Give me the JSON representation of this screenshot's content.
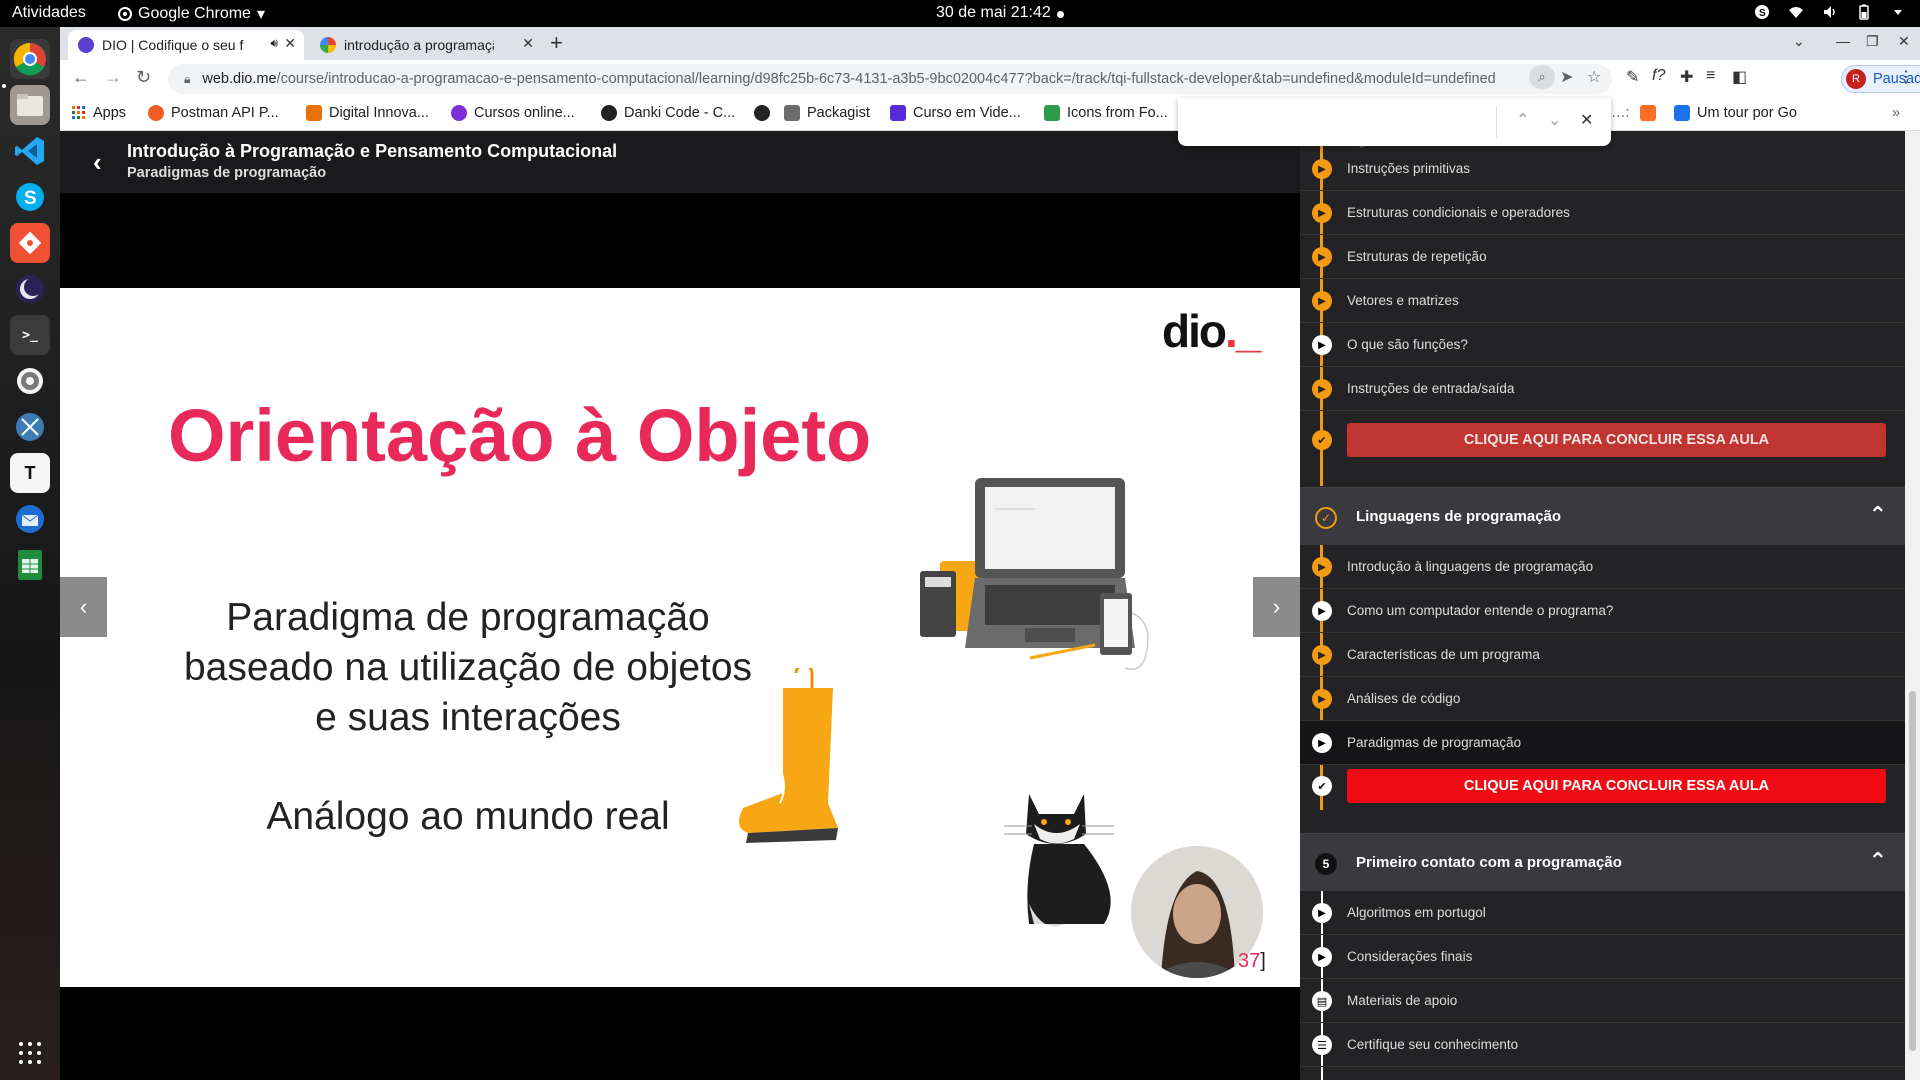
{
  "system_bar": {
    "activities": "Atividades",
    "app_name": "Google Chrome",
    "datetime": "30 de mai  21:42"
  },
  "tabs": [
    {
      "title": "DIO | Codifique o seu f",
      "active": true,
      "audio": true
    },
    {
      "title": "introdução a programação",
      "active": false
    }
  ],
  "toolbar": {
    "url_host": "web.dio.me",
    "url_path": "/course/introducao-a-programacao-e-pensamento-computacional/learning/d98fc25b-6c73-4131-a3b5-9bc02004c477?back=/track/tqi-fullstack-developer&tab=undefined&moduleId=undefined",
    "profile_initial": "R",
    "profile_label": "Pausada"
  },
  "bookmarks": [
    {
      "label": "Apps",
      "color": "#e8710a"
    },
    {
      "label": "Postman API P...",
      "color": "#ef5b25"
    },
    {
      "label": "Digital Innova...",
      "color": "#e8710a"
    },
    {
      "label": "Cursos online...",
      "color": "#7b2fd6"
    },
    {
      "label": "Danki Code - C...",
      "color": "#222222"
    },
    {
      "label": "",
      "color": "#222222"
    },
    {
      "label": "Packagist",
      "color": "#6d6d6d"
    },
    {
      "label": "Curso em Vide...",
      "color": "#5b2ad8"
    },
    {
      "label": "Icons from Fo...",
      "color": "#2e9b4a"
    },
    {
      "label": "Um tour por Go",
      "color": "#1a73e8"
    }
  ],
  "find_bar": {
    "query": ""
  },
  "course": {
    "title": "Introdução à Programação e Pensamento Computacional",
    "lesson": "Paradigmas de programação"
  },
  "slide": {
    "logo": "dio",
    "title": "Orientação à Objeto",
    "body_line1": "Paradigma de programação",
    "body_line2": "baseado na utilização de objetos",
    "body_line3": "e suas interações",
    "analog": "Análogo ao mundo real",
    "page_number": "37"
  },
  "sidebar": {
    "lessons_top": [
      {
        "label": "Instruções primitivas",
        "icon": "play-orange"
      },
      {
        "label": "Estruturas condicionais e operadores",
        "icon": "play-orange"
      },
      {
        "label": "Estruturas de repetição",
        "icon": "play-orange"
      },
      {
        "label": "Vetores e matrizes",
        "icon": "play-orange"
      },
      {
        "label": "O que são funções?",
        "icon": "play-white"
      },
      {
        "label": "Instruções de entrada/saída",
        "icon": "play-orange"
      }
    ],
    "cta_1": "CLIQUE AQUI PARA CONCLUIR ESSA AULA",
    "module_1": {
      "title": "Linguagens de programação"
    },
    "lessons_mid": [
      {
        "label": "Introdução à linguagens de programação",
        "icon": "play-orange"
      },
      {
        "label": "Como um computador entende o programa?",
        "icon": "play-white"
      },
      {
        "label": "Características de um programa",
        "icon": "play-orange"
      },
      {
        "label": "Análises de código",
        "icon": "play-orange"
      },
      {
        "label": "Paradigmas de programação",
        "icon": "play-white"
      }
    ],
    "cta_2": "CLIQUE AQUI PARA CONCLUIR ESSA AULA",
    "module_2": {
      "number": "5",
      "title": "Primeiro contato com a programação"
    },
    "lessons_bottom": [
      {
        "label": "Algoritmos em portugol",
        "icon": "play-white"
      },
      {
        "label": "Considerações finais",
        "icon": "play-white"
      },
      {
        "label": "Materiais de apoio",
        "icon": "doc-white"
      },
      {
        "label": "Certifique seu conhecimento",
        "icon": "list-white"
      }
    ]
  }
}
